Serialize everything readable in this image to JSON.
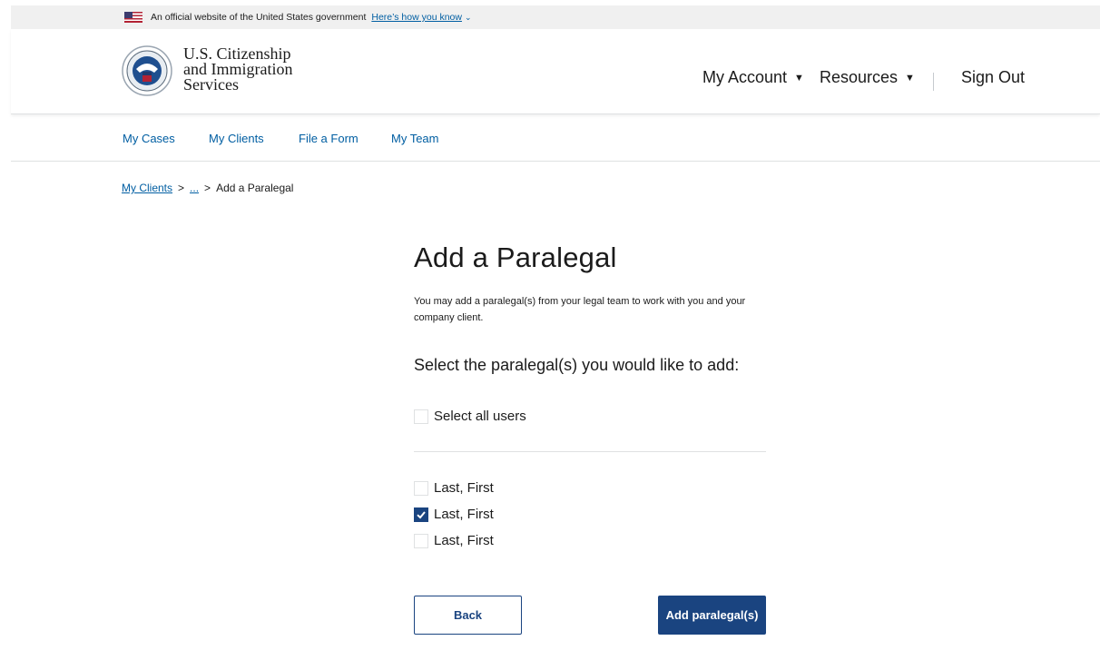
{
  "banner": {
    "text": "An official website of the United States government",
    "link": "Here’s how you know",
    "chevron": "⌄"
  },
  "header": {
    "brand_line1": "U.S. Citizenship",
    "brand_line2": "and Immigration",
    "brand_line3": "Services",
    "nav": {
      "my_account": "My Account",
      "resources": "Resources",
      "sign_out": "Sign Out"
    }
  },
  "subnav": {
    "items": [
      "My Cases",
      "My Clients",
      "File a Form",
      "My Team"
    ]
  },
  "breadcrumb": {
    "items": [
      "My Clients",
      "...",
      "Add a Paralegal"
    ],
    "separator": ">"
  },
  "main": {
    "title": "Add a Paralegal",
    "intro": "You may add a paralegal(s) from your legal team to work with you and your company client.",
    "select_heading": "Select the paralegal(s) you would like to add:",
    "select_all_label": "Select all users",
    "select_all_checked": false,
    "users": [
      {
        "name": "Last, First",
        "checked": false
      },
      {
        "name": "Last, First",
        "checked": true
      },
      {
        "name": "Last, First",
        "checked": false
      }
    ]
  },
  "actions": {
    "back_label": "Back",
    "add_label": "Add paralegal(s)"
  },
  "colors": {
    "primary": "#1a4480",
    "link": "#005ea2",
    "border": "#dfe1e2"
  }
}
